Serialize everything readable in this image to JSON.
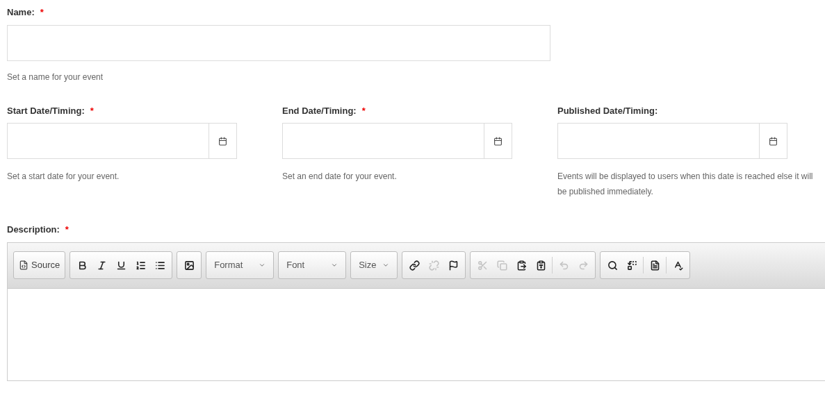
{
  "name_field": {
    "label": "Name:",
    "required_mark": "*",
    "help": "Set a name for your event"
  },
  "date_fields": [
    {
      "label": "Start Date/Timing:",
      "required_mark": "*",
      "help": "Set a start date for your event."
    },
    {
      "label": "End Date/Timing:",
      "required_mark": "*",
      "help": "Set an end date for your event."
    },
    {
      "label": "Published Date/Timing:",
      "help": "Events will be displayed to users when this date is reached else it will be published immediately."
    }
  ],
  "description": {
    "label": "Description:",
    "required_mark": "*",
    "toolbar": [
      [
        {
          "kind": "labeled",
          "label": "Source",
          "disabled": false
        }
      ],
      [
        {
          "kind": "icon",
          "disabled": false
        },
        {
          "kind": "icon",
          "disabled": false
        },
        {
          "kind": "icon",
          "disabled": false
        },
        {
          "kind": "icon",
          "disabled": false
        },
        {
          "kind": "icon",
          "disabled": false
        }
      ],
      [
        {
          "kind": "icon",
          "disabled": false
        }
      ],
      [
        {
          "kind": "dropdown",
          "label": "Format"
        }
      ],
      [
        {
          "kind": "dropdown",
          "label": "Font"
        }
      ],
      [
        {
          "kind": "dropdown",
          "label": "Size"
        }
      ],
      [
        {
          "kind": "icon",
          "disabled": false
        },
        {
          "kind": "icon",
          "disabled": true
        },
        {
          "kind": "icon",
          "disabled": false
        }
      ],
      [
        {
          "kind": "icon",
          "disabled": true
        },
        {
          "kind": "icon",
          "disabled": true
        },
        {
          "kind": "icon",
          "disabled": false
        },
        {
          "kind": "icon",
          "disabled": false
        },
        {
          "kind": "separator"
        },
        {
          "kind": "icon",
          "disabled": true
        },
        {
          "kind": "icon",
          "disabled": true
        }
      ],
      [
        {
          "kind": "icon",
          "disabled": false
        },
        {
          "kind": "icon",
          "disabled": false
        },
        {
          "kind": "separator"
        },
        {
          "kind": "icon",
          "disabled": false
        },
        {
          "kind": "separator"
        },
        {
          "kind": "icon",
          "disabled": false
        }
      ]
    ]
  }
}
